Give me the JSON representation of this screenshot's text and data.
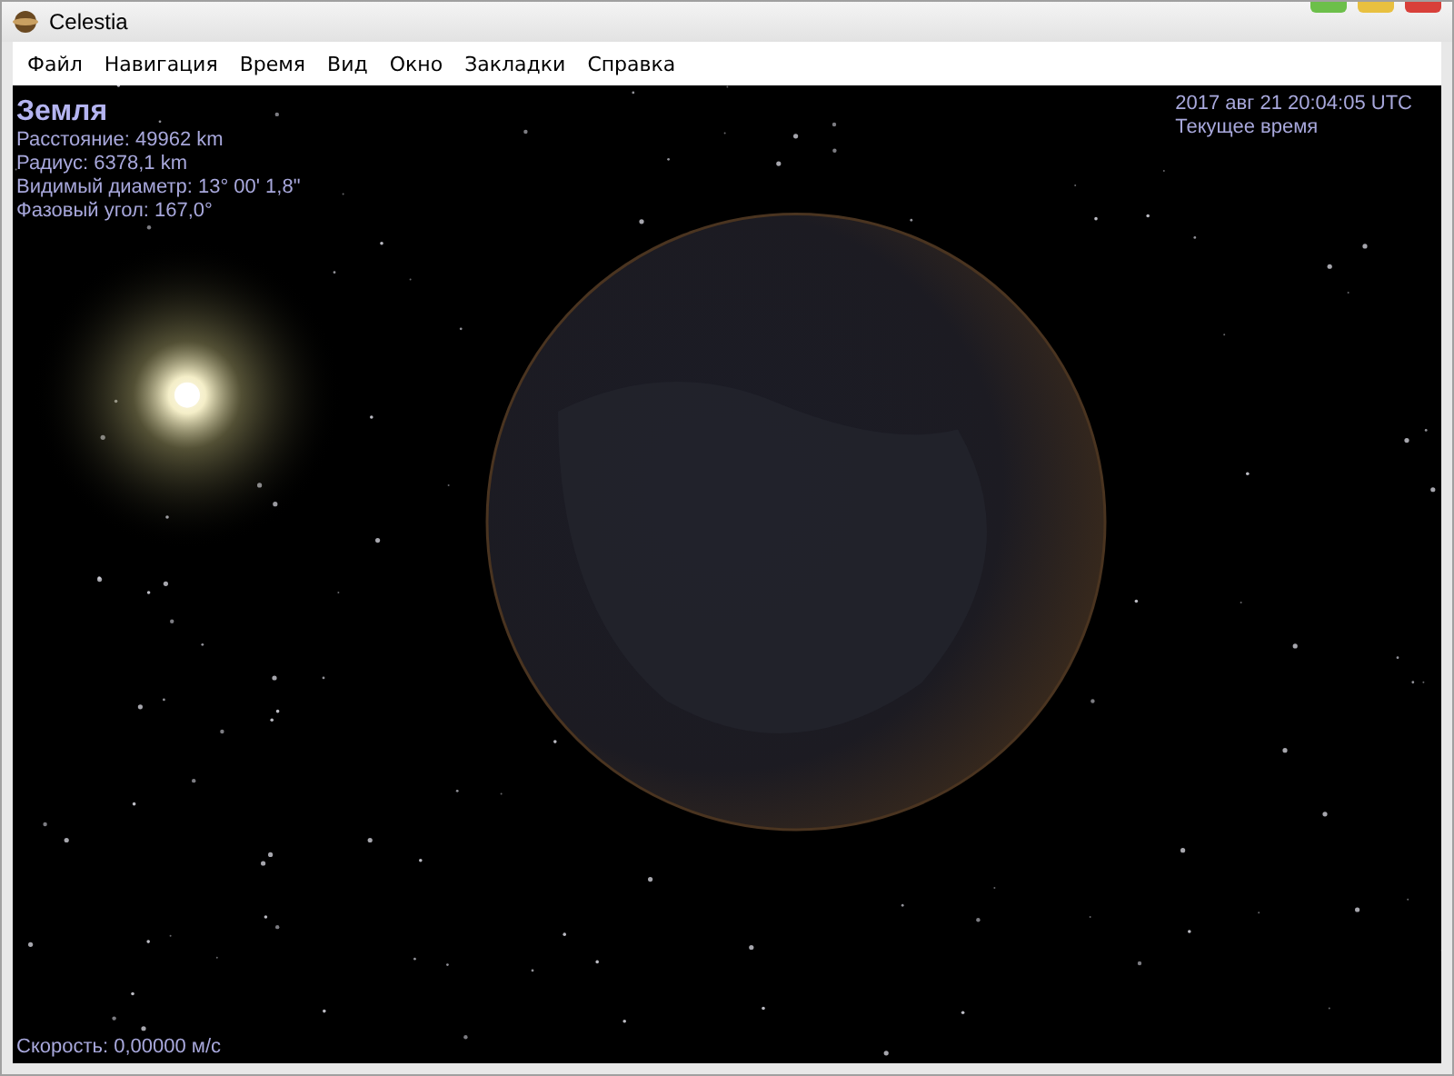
{
  "window": {
    "title": "Celestia"
  },
  "menu": [
    {
      "label": "Файл"
    },
    {
      "label": "Навигация"
    },
    {
      "label": "Время"
    },
    {
      "label": "Вид"
    },
    {
      "label": "Окно"
    },
    {
      "label": "Закладки"
    },
    {
      "label": "Справка"
    }
  ],
  "object_info": {
    "name": "Земля",
    "lines": [
      "Расстояние: 49962 km",
      "Радиус: 6378,1 km",
      "Видимый диаметр: 13° 00' 1,8\"",
      "Фазовый угол: 167,0°"
    ]
  },
  "time_info": {
    "datetime": "2017 авг 21 20:04:05 UTC",
    "mode": "Текущее время"
  },
  "status": {
    "speed": "Скорость: 0,00000 м/с"
  }
}
